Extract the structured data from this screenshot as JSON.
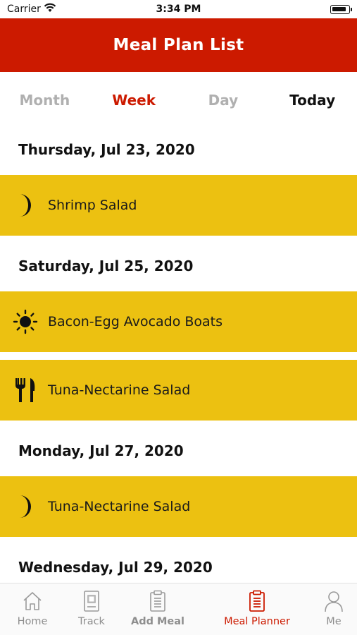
{
  "status_bar": {
    "carrier": "Carrier",
    "time": "3:34 PM"
  },
  "nav": {
    "title": "Meal Plan List"
  },
  "segments": [
    {
      "label": "Month"
    },
    {
      "label": "Week"
    },
    {
      "label": "Day"
    },
    {
      "label": "Today"
    }
  ],
  "selected_segment": "Week",
  "days": [
    {
      "date": "Thursday, Jul 23, 2020",
      "meals": [
        {
          "name": "Shrimp Salad",
          "icon": "moon-icon"
        }
      ]
    },
    {
      "date": "Saturday, Jul 25, 2020",
      "meals": [
        {
          "name": "Bacon-Egg Avocado Boats",
          "icon": "sun-icon"
        },
        {
          "name": "Tuna-Nectarine Salad",
          "icon": "fork-knife-icon"
        }
      ]
    },
    {
      "date": "Monday, Jul 27, 2020",
      "meals": [
        {
          "name": "Tuna-Nectarine Salad",
          "icon": "moon-icon"
        }
      ]
    },
    {
      "date": "Wednesday, Jul 29, 2020",
      "meals": []
    }
  ],
  "tab_bar": {
    "items": [
      {
        "label": "Home",
        "icon": "home-icon"
      },
      {
        "label": "Track",
        "icon": "track-icon"
      },
      {
        "label": "Add Meal",
        "icon": "add-meal-icon"
      },
      {
        "label": "Meal Planner",
        "icon": "meal-planner-icon"
      },
      {
        "label": "Me",
        "icon": "person-icon"
      }
    ],
    "selected": "Meal Planner"
  },
  "colors": {
    "brand_red": "#cc1a00",
    "meal_row_yellow": "#ecc111",
    "inactive_gray": "#b0b0b0"
  }
}
